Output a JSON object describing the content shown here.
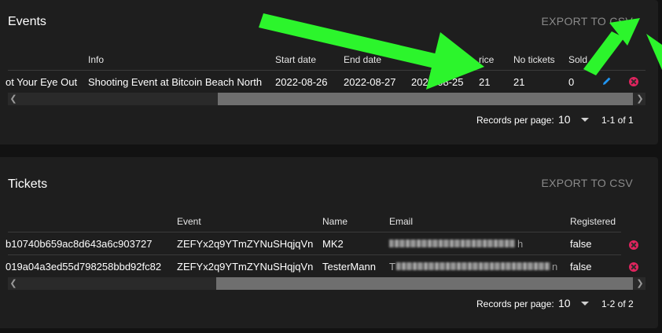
{
  "events": {
    "title": "Events",
    "export_label": "EXPORT TO CSV",
    "columns": [
      "Info",
      "Start date",
      "End date",
      "Ticke",
      "rice",
      "No tickets",
      "Sold"
    ],
    "row": {
      "name": "ot Your Eye Out",
      "info": "Shooting Event at Bitcoin Beach North",
      "start_date": "2022-08-26",
      "end_date": "2022-08-27",
      "ticket_date": "2022-08-25",
      "price": "21",
      "no_tickets": "21",
      "sold": "0"
    },
    "pagination": {
      "label": "Records per page:",
      "value": "10",
      "range": "1-1 of 1"
    }
  },
  "tickets": {
    "title": "Tickets",
    "export_label": "EXPORT TO CSV",
    "columns": [
      "Event",
      "Name",
      "Email",
      "Registered"
    ],
    "rows": [
      {
        "id": "b10740b659ac8d643a6c903727",
        "event": "ZEFYx2q9YTmZYNuSHqjqVn",
        "name": "MK2",
        "email_tail": "h",
        "registered": "false"
      },
      {
        "id": "019a04a3ed55d798258bbd92fc82",
        "event": "ZEFYx2q9YTmZYNuSHqjqVn",
        "name": "TesterMann",
        "email_head": "T",
        "email_tail": "n",
        "registered": "false"
      }
    ],
    "pagination": {
      "label": "Records per page:",
      "value": "10",
      "range": "1-2 of 2"
    }
  },
  "colors": {
    "card": "#1e1e1e",
    "background": "#121212",
    "accent_arrow": "#2cf52c",
    "edit": "#2196f3",
    "delete": "#e0245e"
  }
}
